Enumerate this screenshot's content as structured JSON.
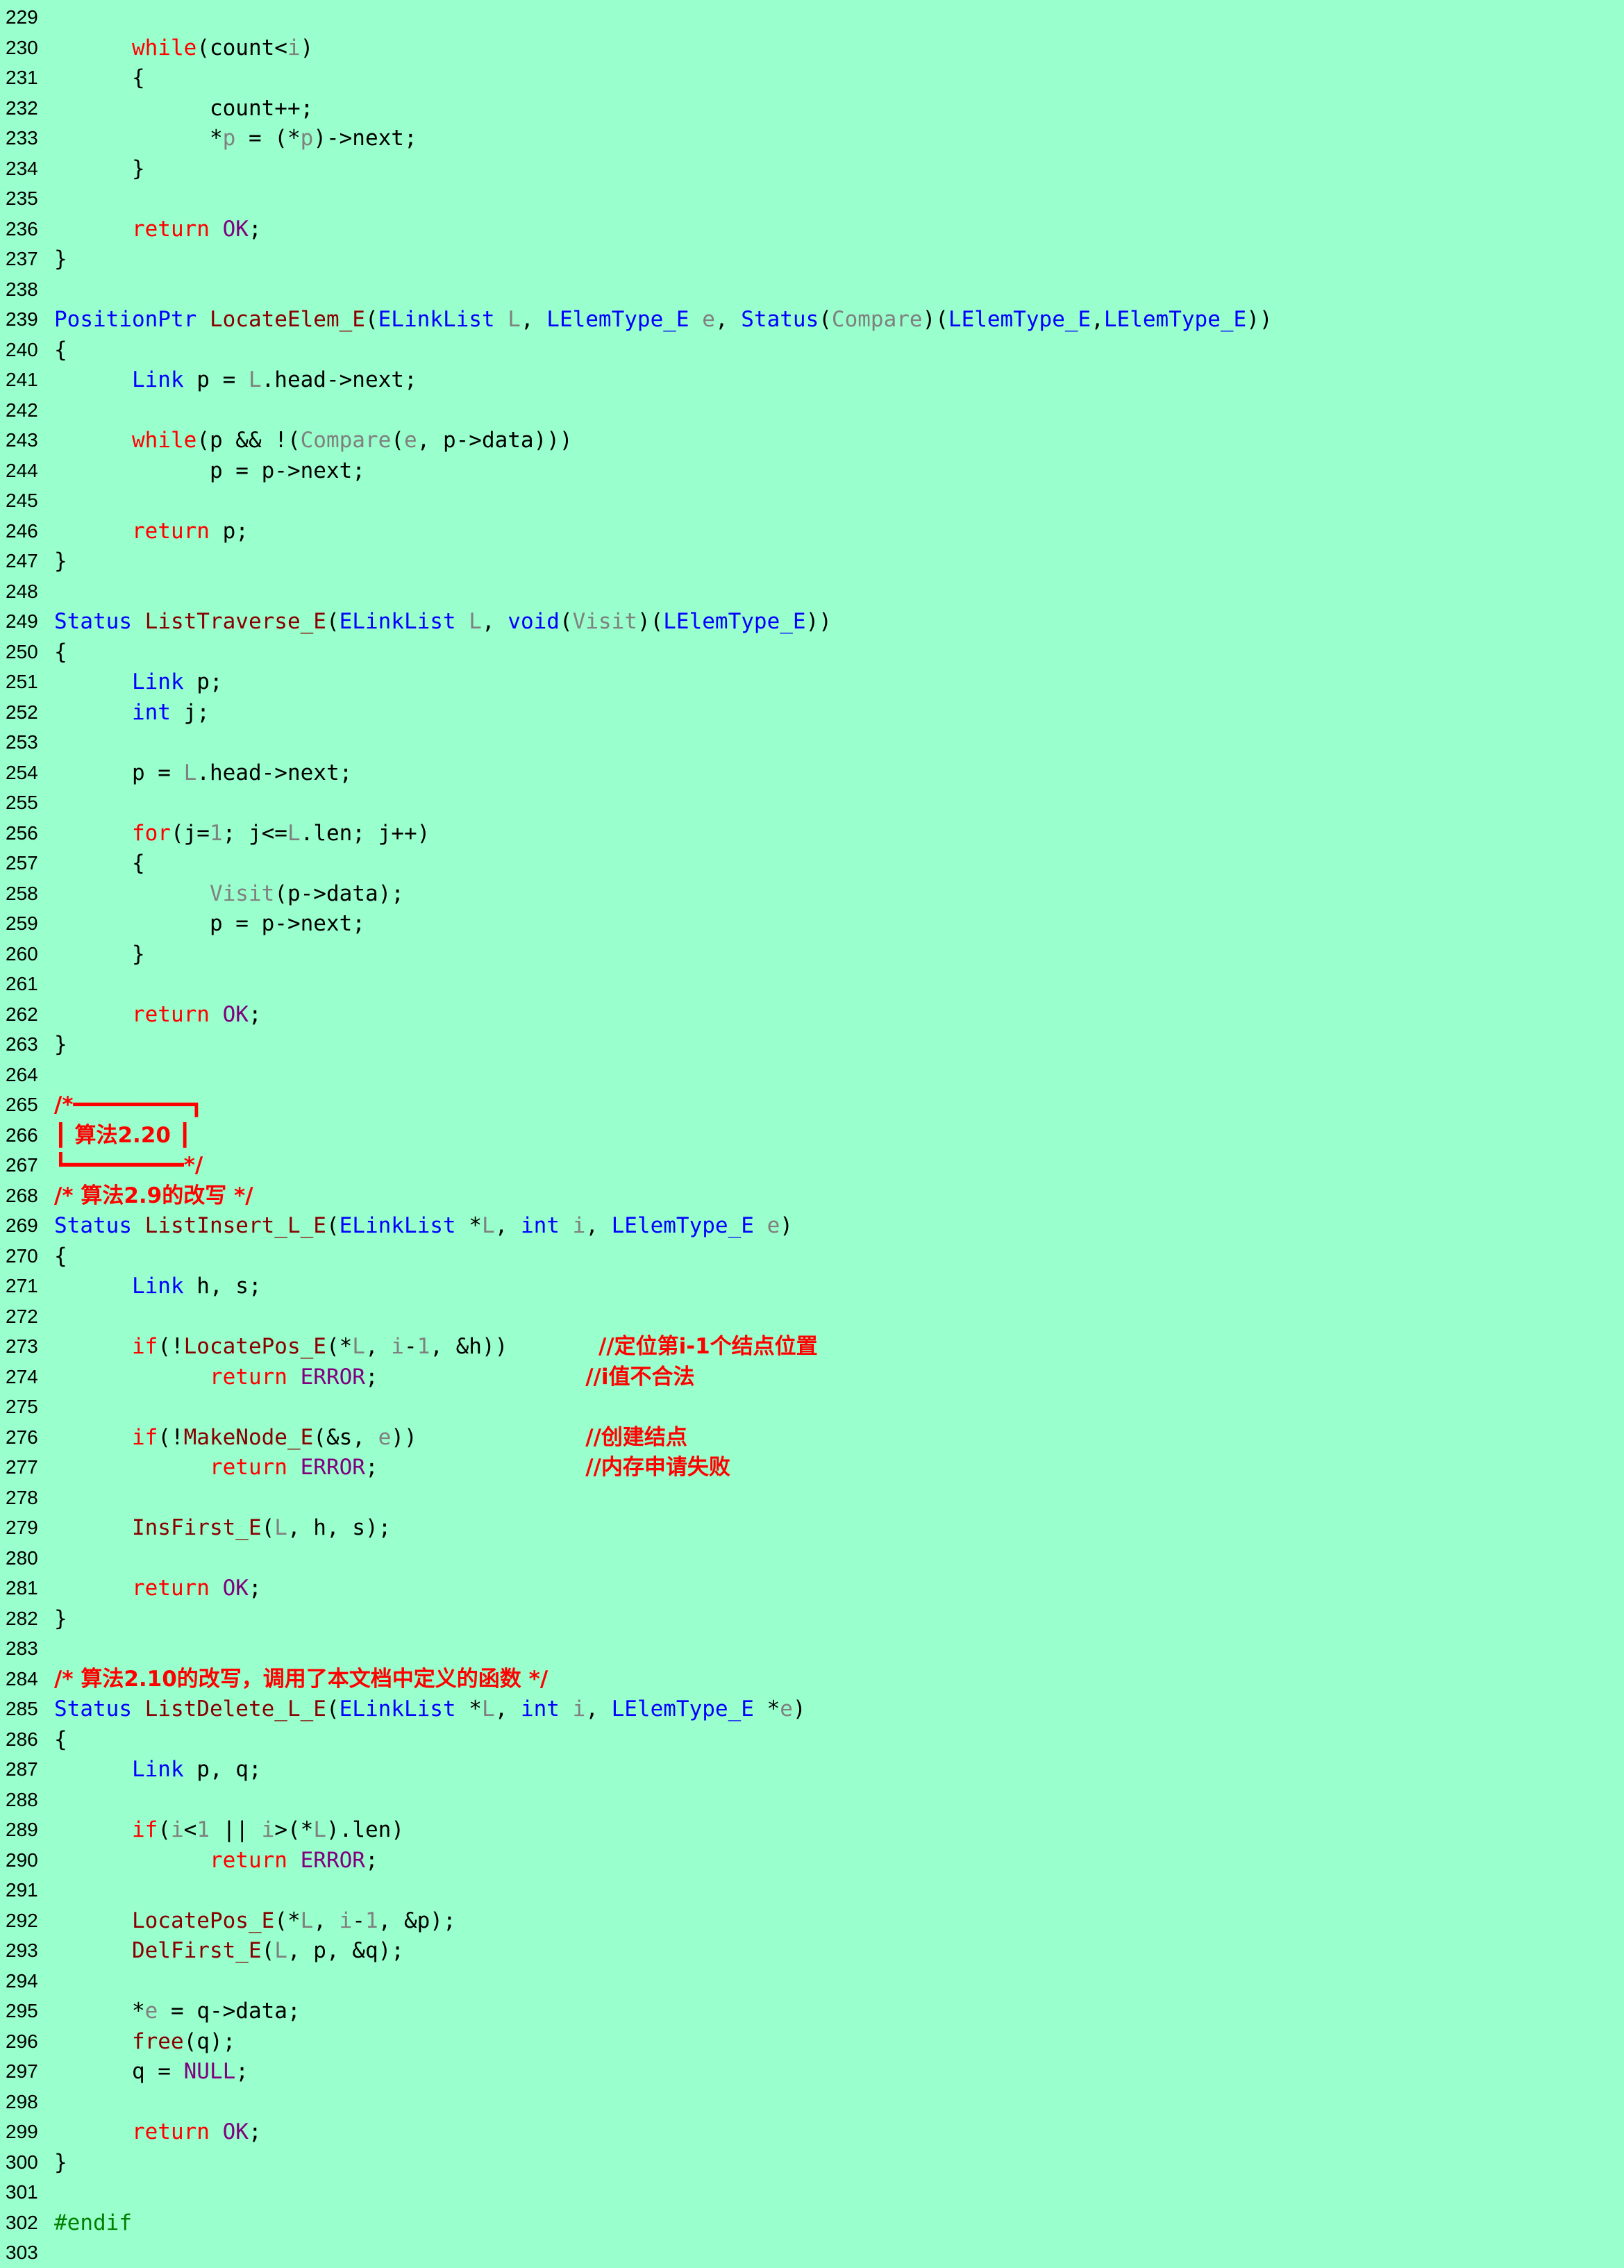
{
  "editor": {
    "background": "#99ffcc",
    "colors": {
      "kw": "#ff0000",
      "ty": "#0000ff",
      "fn": "#880000",
      "pa": "#808080",
      "co": "#800080",
      "cm": "#ff0000",
      "pp": "#008000",
      "pl": "#000000"
    },
    "lines": [
      {
        "n": "229",
        "t": []
      },
      {
        "n": "230",
        "t": [
          [
            "pl",
            "      "
          ],
          [
            "kw",
            "while"
          ],
          [
            "pl",
            "(count<"
          ],
          [
            "pa",
            "i"
          ],
          [
            "pl",
            ")"
          ]
        ]
      },
      {
        "n": "231",
        "t": [
          [
            "pl",
            "      {"
          ]
        ]
      },
      {
        "n": "232",
        "t": [
          [
            "pl",
            "            count++;"
          ]
        ]
      },
      {
        "n": "233",
        "t": [
          [
            "pl",
            "            *"
          ],
          [
            "pa",
            "p"
          ],
          [
            "pl",
            " = (*"
          ],
          [
            "pa",
            "p"
          ],
          [
            "pl",
            ")->next;"
          ]
        ]
      },
      {
        "n": "234",
        "t": [
          [
            "pl",
            "      }"
          ]
        ]
      },
      {
        "n": "235",
        "t": []
      },
      {
        "n": "236",
        "t": [
          [
            "pl",
            "      "
          ],
          [
            "kw",
            "return"
          ],
          [
            "pl",
            " "
          ],
          [
            "co",
            "OK"
          ],
          [
            "pl",
            ";"
          ]
        ]
      },
      {
        "n": "237",
        "t": [
          [
            "pl",
            "}"
          ]
        ]
      },
      {
        "n": "238",
        "t": []
      },
      {
        "n": "239",
        "t": [
          [
            "ty",
            "PositionPtr"
          ],
          [
            "pl",
            " "
          ],
          [
            "fn",
            "LocateElem_E"
          ],
          [
            "pl",
            "("
          ],
          [
            "ty",
            "ELinkList"
          ],
          [
            "pl",
            " "
          ],
          [
            "pa",
            "L"
          ],
          [
            "pl",
            ", "
          ],
          [
            "ty",
            "LElemType_E"
          ],
          [
            "pl",
            " "
          ],
          [
            "pa",
            "e"
          ],
          [
            "pl",
            ", "
          ],
          [
            "ty",
            "Status"
          ],
          [
            "pl",
            "("
          ],
          [
            "pa",
            "Compare"
          ],
          [
            "pl",
            ")("
          ],
          [
            "ty",
            "LElemType_E"
          ],
          [
            "pl",
            ","
          ],
          [
            "ty",
            "LElemType_E"
          ],
          [
            "pl",
            "))"
          ]
        ]
      },
      {
        "n": "240",
        "t": [
          [
            "pl",
            "{"
          ]
        ]
      },
      {
        "n": "241",
        "t": [
          [
            "pl",
            "      "
          ],
          [
            "ty",
            "Link"
          ],
          [
            "pl",
            " p = "
          ],
          [
            "pa",
            "L"
          ],
          [
            "pl",
            ".head->next;"
          ]
        ]
      },
      {
        "n": "242",
        "t": []
      },
      {
        "n": "243",
        "t": [
          [
            "pl",
            "      "
          ],
          [
            "kw",
            "while"
          ],
          [
            "pl",
            "(p && !("
          ],
          [
            "pa",
            "Compare"
          ],
          [
            "pl",
            "("
          ],
          [
            "pa",
            "e"
          ],
          [
            "pl",
            ", p->data)))"
          ]
        ]
      },
      {
        "n": "244",
        "t": [
          [
            "pl",
            "            p = p->next;"
          ]
        ]
      },
      {
        "n": "245",
        "t": []
      },
      {
        "n": "246",
        "t": [
          [
            "pl",
            "      "
          ],
          [
            "kw",
            "return"
          ],
          [
            "pl",
            " p;"
          ]
        ]
      },
      {
        "n": "247",
        "t": [
          [
            "pl",
            "}"
          ]
        ]
      },
      {
        "n": "248",
        "t": []
      },
      {
        "n": "249",
        "t": [
          [
            "ty",
            "Status"
          ],
          [
            "pl",
            " "
          ],
          [
            "fn",
            "ListTraverse_E"
          ],
          [
            "pl",
            "("
          ],
          [
            "ty",
            "ELinkList"
          ],
          [
            "pl",
            " "
          ],
          [
            "pa",
            "L"
          ],
          [
            "pl",
            ", "
          ],
          [
            "ty",
            "void"
          ],
          [
            "pl",
            "("
          ],
          [
            "pa",
            "Visit"
          ],
          [
            "pl",
            ")("
          ],
          [
            "ty",
            "LElemType_E"
          ],
          [
            "pl",
            "))"
          ]
        ]
      },
      {
        "n": "250",
        "t": [
          [
            "pl",
            "{"
          ]
        ]
      },
      {
        "n": "251",
        "t": [
          [
            "pl",
            "      "
          ],
          [
            "ty",
            "Link"
          ],
          [
            "pl",
            " p;"
          ]
        ]
      },
      {
        "n": "252",
        "t": [
          [
            "pl",
            "      "
          ],
          [
            "ty",
            "int"
          ],
          [
            "pl",
            " j;"
          ]
        ]
      },
      {
        "n": "253",
        "t": []
      },
      {
        "n": "254",
        "t": [
          [
            "pl",
            "      p = "
          ],
          [
            "pa",
            "L"
          ],
          [
            "pl",
            ".head->next;"
          ]
        ]
      },
      {
        "n": "255",
        "t": []
      },
      {
        "n": "256",
        "t": [
          [
            "pl",
            "      "
          ],
          [
            "kw",
            "for"
          ],
          [
            "pl",
            "(j="
          ],
          [
            "pa",
            "1"
          ],
          [
            "pl",
            "; j<="
          ],
          [
            "pa",
            "L"
          ],
          [
            "pl",
            ".len; j++)"
          ]
        ]
      },
      {
        "n": "257",
        "t": [
          [
            "pl",
            "      {"
          ]
        ]
      },
      {
        "n": "258",
        "t": [
          [
            "pl",
            "            "
          ],
          [
            "pa",
            "Visit"
          ],
          [
            "pl",
            "(p->data);"
          ]
        ]
      },
      {
        "n": "259",
        "t": [
          [
            "pl",
            "            p = p->next;"
          ]
        ]
      },
      {
        "n": "260",
        "t": [
          [
            "pl",
            "      }"
          ]
        ]
      },
      {
        "n": "261",
        "t": []
      },
      {
        "n": "262",
        "t": [
          [
            "pl",
            "      "
          ],
          [
            "kw",
            "return"
          ],
          [
            "pl",
            " "
          ],
          [
            "co",
            "OK"
          ],
          [
            "pl",
            ";"
          ]
        ]
      },
      {
        "n": "263",
        "t": [
          [
            "pl",
            "}"
          ]
        ]
      },
      {
        "n": "264",
        "t": []
      },
      {
        "n": "265",
        "t": [
          [
            "cm",
            "/*━━━━━━━━━┓"
          ]
        ]
      },
      {
        "n": "266",
        "t": [
          [
            "cm",
            "┃ 算法2.20 ┃"
          ]
        ]
      },
      {
        "n": "267",
        "t": [
          [
            "cm",
            "┗━━━━━━━━━*/"
          ]
        ]
      },
      {
        "n": "268",
        "t": [
          [
            "cm",
            "/* 算法2.9的改写 */"
          ]
        ]
      },
      {
        "n": "269",
        "t": [
          [
            "ty",
            "Status"
          ],
          [
            "pl",
            " "
          ],
          [
            "fn",
            "ListInsert_L_E"
          ],
          [
            "pl",
            "("
          ],
          [
            "ty",
            "ELinkList"
          ],
          [
            "pl",
            " *"
          ],
          [
            "pa",
            "L"
          ],
          [
            "pl",
            ", "
          ],
          [
            "ty",
            "int"
          ],
          [
            "pl",
            " "
          ],
          [
            "pa",
            "i"
          ],
          [
            "pl",
            ", "
          ],
          [
            "ty",
            "LElemType_E"
          ],
          [
            "pl",
            " "
          ],
          [
            "pa",
            "e"
          ],
          [
            "pl",
            ")"
          ]
        ]
      },
      {
        "n": "270",
        "t": [
          [
            "pl",
            "{"
          ]
        ]
      },
      {
        "n": "271",
        "t": [
          [
            "pl",
            "      "
          ],
          [
            "ty",
            "Link"
          ],
          [
            "pl",
            " h, s;"
          ]
        ]
      },
      {
        "n": "272",
        "t": []
      },
      {
        "n": "273",
        "t": [
          [
            "pl",
            "      "
          ],
          [
            "kw",
            "if"
          ],
          [
            "pl",
            "(!"
          ],
          [
            "fn",
            "LocatePos_E"
          ],
          [
            "pl",
            "(*"
          ],
          [
            "pa",
            "L"
          ],
          [
            "pl",
            ", "
          ],
          [
            "pa",
            "i"
          ],
          [
            "pl",
            "-"
          ],
          [
            "pa",
            "1"
          ],
          [
            "pl",
            ", &h))       "
          ],
          [
            "cm",
            "//定位第i-1个结点位置"
          ]
        ]
      },
      {
        "n": "274",
        "t": [
          [
            "pl",
            "            "
          ],
          [
            "kw",
            "return"
          ],
          [
            "pl",
            " "
          ],
          [
            "co",
            "ERROR"
          ],
          [
            "pl",
            ";                "
          ],
          [
            "cm",
            "//i值不合法"
          ]
        ]
      },
      {
        "n": "275",
        "t": []
      },
      {
        "n": "276",
        "t": [
          [
            "pl",
            "      "
          ],
          [
            "kw",
            "if"
          ],
          [
            "pl",
            "(!"
          ],
          [
            "fn",
            "MakeNode_E"
          ],
          [
            "pl",
            "(&s, "
          ],
          [
            "pa",
            "e"
          ],
          [
            "pl",
            "))             "
          ],
          [
            "cm",
            "//创建结点"
          ]
        ]
      },
      {
        "n": "277",
        "t": [
          [
            "pl",
            "            "
          ],
          [
            "kw",
            "return"
          ],
          [
            "pl",
            " "
          ],
          [
            "co",
            "ERROR"
          ],
          [
            "pl",
            ";                "
          ],
          [
            "cm",
            "//内存申请失败"
          ]
        ]
      },
      {
        "n": "278",
        "t": []
      },
      {
        "n": "279",
        "t": [
          [
            "pl",
            "      "
          ],
          [
            "fn",
            "InsFirst_E"
          ],
          [
            "pl",
            "("
          ],
          [
            "pa",
            "L"
          ],
          [
            "pl",
            ", h, s);"
          ]
        ]
      },
      {
        "n": "280",
        "t": []
      },
      {
        "n": "281",
        "t": [
          [
            "pl",
            "      "
          ],
          [
            "kw",
            "return"
          ],
          [
            "pl",
            " "
          ],
          [
            "co",
            "OK"
          ],
          [
            "pl",
            ";"
          ]
        ]
      },
      {
        "n": "282",
        "t": [
          [
            "pl",
            "}"
          ]
        ]
      },
      {
        "n": "283",
        "t": []
      },
      {
        "n": "284",
        "t": [
          [
            "cm",
            "/* 算法2.10的改写，调用了本文档中定义的函数 */"
          ]
        ]
      },
      {
        "n": "285",
        "t": [
          [
            "ty",
            "Status"
          ],
          [
            "pl",
            " "
          ],
          [
            "fn",
            "ListDelete_L_E"
          ],
          [
            "pl",
            "("
          ],
          [
            "ty",
            "ELinkList"
          ],
          [
            "pl",
            " *"
          ],
          [
            "pa",
            "L"
          ],
          [
            "pl",
            ", "
          ],
          [
            "ty",
            "int"
          ],
          [
            "pl",
            " "
          ],
          [
            "pa",
            "i"
          ],
          [
            "pl",
            ", "
          ],
          [
            "ty",
            "LElemType_E"
          ],
          [
            "pl",
            " *"
          ],
          [
            "pa",
            "e"
          ],
          [
            "pl",
            ")"
          ]
        ]
      },
      {
        "n": "286",
        "t": [
          [
            "pl",
            "{"
          ]
        ]
      },
      {
        "n": "287",
        "t": [
          [
            "pl",
            "      "
          ],
          [
            "ty",
            "Link"
          ],
          [
            "pl",
            " p, q;"
          ]
        ]
      },
      {
        "n": "288",
        "t": []
      },
      {
        "n": "289",
        "t": [
          [
            "pl",
            "      "
          ],
          [
            "kw",
            "if"
          ],
          [
            "pl",
            "("
          ],
          [
            "pa",
            "i"
          ],
          [
            "pl",
            "<"
          ],
          [
            "pa",
            "1"
          ],
          [
            "pl",
            " || "
          ],
          [
            "pa",
            "i"
          ],
          [
            "pl",
            ">(*"
          ],
          [
            "pa",
            "L"
          ],
          [
            "pl",
            ").len)"
          ]
        ]
      },
      {
        "n": "290",
        "t": [
          [
            "pl",
            "            "
          ],
          [
            "kw",
            "return"
          ],
          [
            "pl",
            " "
          ],
          [
            "co",
            "ERROR"
          ],
          [
            "pl",
            ";"
          ]
        ]
      },
      {
        "n": "291",
        "t": []
      },
      {
        "n": "292",
        "t": [
          [
            "pl",
            "      "
          ],
          [
            "fn",
            "LocatePos_E"
          ],
          [
            "pl",
            "(*"
          ],
          [
            "pa",
            "L"
          ],
          [
            "pl",
            ", "
          ],
          [
            "pa",
            "i"
          ],
          [
            "pl",
            "-"
          ],
          [
            "pa",
            "1"
          ],
          [
            "pl",
            ", &p);"
          ]
        ]
      },
      {
        "n": "293",
        "t": [
          [
            "pl",
            "      "
          ],
          [
            "fn",
            "DelFirst_E"
          ],
          [
            "pl",
            "("
          ],
          [
            "pa",
            "L"
          ],
          [
            "pl",
            ", p, &q);"
          ]
        ]
      },
      {
        "n": "294",
        "t": []
      },
      {
        "n": "295",
        "t": [
          [
            "pl",
            "      *"
          ],
          [
            "pa",
            "e"
          ],
          [
            "pl",
            " = q->data;"
          ]
        ]
      },
      {
        "n": "296",
        "t": [
          [
            "pl",
            "      "
          ],
          [
            "fn",
            "free"
          ],
          [
            "pl",
            "(q);"
          ]
        ]
      },
      {
        "n": "297",
        "t": [
          [
            "pl",
            "      q = "
          ],
          [
            "co",
            "NULL"
          ],
          [
            "pl",
            ";"
          ]
        ]
      },
      {
        "n": "298",
        "t": []
      },
      {
        "n": "299",
        "t": [
          [
            "pl",
            "      "
          ],
          [
            "kw",
            "return"
          ],
          [
            "pl",
            " "
          ],
          [
            "co",
            "OK"
          ],
          [
            "pl",
            ";"
          ]
        ]
      },
      {
        "n": "300",
        "t": [
          [
            "pl",
            "}"
          ]
        ]
      },
      {
        "n": "301",
        "t": []
      },
      {
        "n": "302",
        "t": [
          [
            "pp",
            "#endif"
          ]
        ]
      },
      {
        "n": "303",
        "t": []
      }
    ]
  }
}
